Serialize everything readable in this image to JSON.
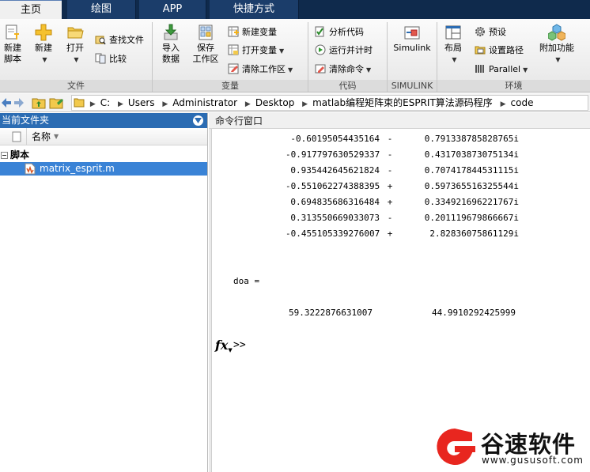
{
  "tabs": [
    {
      "label": "主页",
      "active": true
    },
    {
      "label": "绘图",
      "active": false
    },
    {
      "label": "APP",
      "active": false
    },
    {
      "label": "快捷方式",
      "active": false
    }
  ],
  "ribbon": {
    "file": {
      "group_label": "文件",
      "new_script": "新建\n脚本",
      "new": "新建",
      "open": "打开",
      "find_files": "查找文件",
      "compare": "比较"
    },
    "variable": {
      "group_label": "变量",
      "import": "导入\n数据",
      "save_workspace": "保存\n工作区",
      "new_variable": "新建变量",
      "open_variable": "打开变量",
      "clear_workspace": "清除工作区"
    },
    "code": {
      "group_label": "代码",
      "analyze": "分析代码",
      "run_time": "运行并计时",
      "clear_commands": "清除命令"
    },
    "simulink": {
      "group_label": "SIMULINK",
      "simulink": "Simulink"
    },
    "environment": {
      "group_label": "环境",
      "layout": "布局",
      "preferences": "预设",
      "set_path": "设置路径",
      "parallel": "Parallel",
      "addons": "附加功能"
    }
  },
  "address": {
    "crumbs": [
      "C:",
      "Users",
      "Administrator",
      "Desktop",
      "matlab编程矩阵束的ESPRIT算法源码程序",
      "code"
    ]
  },
  "left_panel": {
    "title": "当前文件夹",
    "column_name": "名称",
    "group": "脚本",
    "file": "matrix_esprit.m"
  },
  "command_window": {
    "title": "命令行窗口",
    "complex_rows": [
      {
        "re": "-0.60195054435164",
        "sign": "-",
        "im": "0.791338785828765i"
      },
      {
        "re": "-0.917797630529337",
        "sign": "-",
        "im": "0.431703873075134i"
      },
      {
        "re": "0.935442645621824",
        "sign": "-",
        "im": "0.707417844531115i"
      },
      {
        "re": "-0.551062274388395",
        "sign": "+",
        "im": "0.597365516325544i"
      },
      {
        "re": "0.694835686316484",
        "sign": "+",
        "im": "0.334921696221767i"
      },
      {
        "re": "0.313550669033073",
        "sign": "-",
        "im": "0.201119679866667i"
      },
      {
        "re": "-0.455105339276007",
        "sign": "+",
        "im": "2.82836075861129i"
      }
    ],
    "doa_label": "doa =",
    "doa_values": [
      "59.3222876631007",
      "44.9910292425999"
    ],
    "fx_label": "fx",
    "prompt": ">>"
  },
  "watermark": {
    "text": "谷速软件",
    "url": "www.gususoft.com",
    "color": "#e8261f"
  },
  "colors": {
    "tabbar": "#0f2a4c",
    "panel_title": "#2b6cb3",
    "selection": "#3a83d6"
  }
}
